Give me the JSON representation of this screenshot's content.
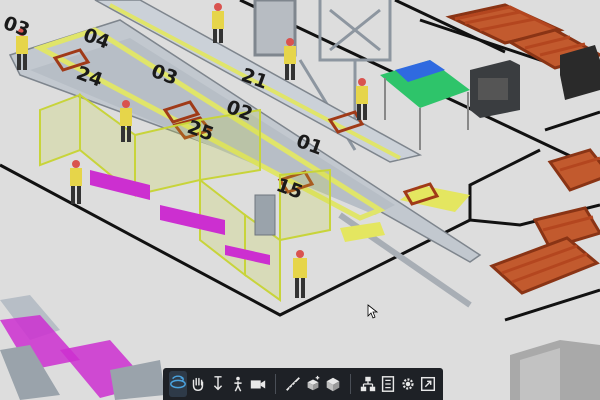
{
  "app": {
    "window_title": ""
  },
  "scene": {
    "station_labels": [
      "03",
      "04",
      "24",
      "03",
      "02",
      "25",
      "01",
      "21",
      "15"
    ]
  },
  "toolbar": {
    "groups": [
      [
        {
          "name": "orbit-icon",
          "active": true
        },
        {
          "name": "pan-hand-icon",
          "active": false
        },
        {
          "name": "zoom-icon",
          "active": false
        },
        {
          "name": "person-walk-icon",
          "active": false
        },
        {
          "name": "camera-icon",
          "active": false
        }
      ],
      [
        {
          "name": "measure-icon",
          "active": false
        },
        {
          "name": "add-object-icon",
          "active": false
        },
        {
          "name": "cube-view-icon",
          "active": false
        }
      ],
      [
        {
          "name": "hierarchy-icon",
          "active": false
        },
        {
          "name": "properties-icon",
          "active": false
        },
        {
          "name": "settings-gear-icon",
          "active": false
        },
        {
          "name": "fullscreen-icon",
          "active": false
        }
      ]
    ]
  },
  "colors": {
    "floor": "#dcdcdc",
    "floor_lines": "#111111",
    "conveyor_frame": "#c9cfd6",
    "safety_fence": "#c8d43a",
    "pallet_rack": "#b4461f",
    "worker_shirt": "#e6d54a",
    "worker_helmet": "#d9534f",
    "magenta_parts": "#cc2fd0",
    "toolbar_bg": "#1e2126",
    "toolbar_icon": "#e8e8e8",
    "toolbar_active": "#4aa3df"
  }
}
